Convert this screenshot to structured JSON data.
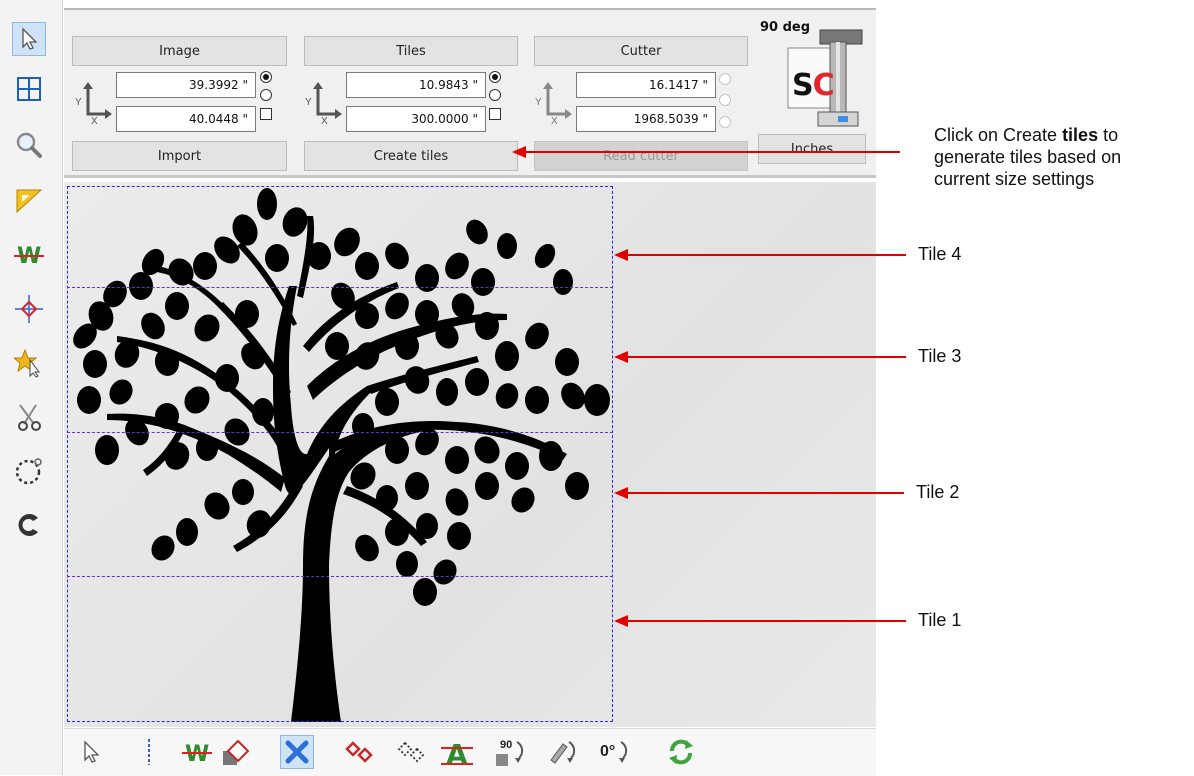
{
  "top_panel": {
    "image": {
      "title": "Image",
      "x_value": "39.3992 \"",
      "y_value": "40.0448 \"",
      "action": "Import"
    },
    "tiles": {
      "title": "Tiles",
      "x_value": "10.9843 \"",
      "y_value": "300.0000 \"",
      "action": "Create tiles"
    },
    "cutter": {
      "title": "Cutter",
      "x_value": "16.1417 \"",
      "y_value": "1968.5039 \"",
      "action": "Read cutter"
    },
    "rotation_label": "90 deg",
    "logo_text": "SC",
    "units_button": "Inches",
    "axis_y": "Y",
    "axis_x": "X"
  },
  "left_toolbar": {
    "tools": [
      "select-arrow-icon",
      "grid-tiles-icon",
      "magnifier-icon",
      "ruler-triangle-icon",
      "weld-w-icon",
      "crosshair-icon",
      "star-select-icon",
      "scissors-icon",
      "dotted-circle-cut-icon",
      "c-logo-icon"
    ]
  },
  "bottom_toolbar": {
    "tools": [
      "select-arrow-icon",
      "divider-line-icon",
      "weld-w-icon",
      "shape-combine-icon",
      "cross-icon",
      "red-diamonds-icon",
      "outline-diamonds-icon",
      "text-a-icon",
      "rotate-90-icon",
      "rotate-pen-icon",
      "rotate-0-icon",
      "refresh-icon"
    ],
    "rotate_90_label": "90",
    "rotate_0_label": "0°"
  },
  "annotations": {
    "create_tiles_prefix": "Click on Create ",
    "create_tiles_bold": "tiles",
    "create_tiles_suffix": " to",
    "create_tiles_line2": "generate tiles based on",
    "create_tiles_line3": "current size settings",
    "tile4": "Tile 4",
    "tile3": "Tile 3",
    "tile2": "Tile 2",
    "tile1": "Tile 1"
  },
  "colors": {
    "annotation_arrow": "#e00000",
    "tile_border": "#2b2bd6",
    "accent": "#cfe3f7"
  }
}
